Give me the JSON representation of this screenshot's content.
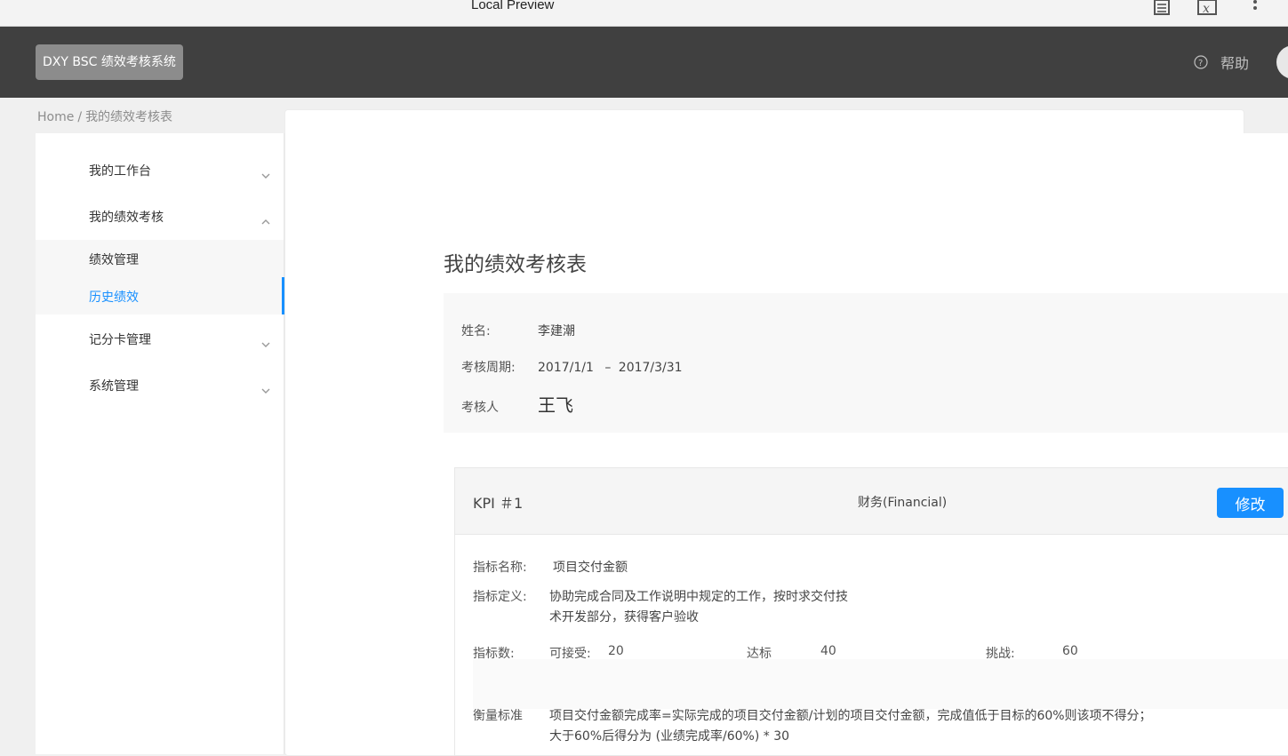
{
  "preview": {
    "title": "Local Preview"
  },
  "header": {
    "brand": "DXY BSC 绩效考核系统",
    "help_label": "帮助"
  },
  "breadcrumb": {
    "home": "Home",
    "separator": "/",
    "current": "我的绩效考核表"
  },
  "sidebar": {
    "items": [
      {
        "label": "我的工作台",
        "expanded": false
      },
      {
        "label": "我的绩效考核",
        "expanded": true,
        "children": [
          {
            "label": "绩效管理"
          },
          {
            "label": "历史绩效",
            "active": true
          }
        ]
      },
      {
        "label": "记分卡管理",
        "expanded": false
      },
      {
        "label": "系统管理",
        "expanded": false
      }
    ]
  },
  "main": {
    "title": "我的绩效考核表",
    "info": {
      "name_label": "姓名:",
      "name_value": "李建潮",
      "period_label": "考核周期:",
      "period_start": "2017/1/1",
      "period_sep": "–",
      "period_end": "2017/3/31",
      "reviewer_label": "考核人",
      "reviewer_value": "王飞"
    },
    "kpi": {
      "number": "KPI ＃1",
      "category": "财务(Financial)",
      "edit_label": "修改",
      "name_label": "指标名称:",
      "name_value": "项目交付金额",
      "definition_label": "指标定义:",
      "definition_lines": [
        "协助完成合同及工作说明中规定的工作，按时求交付技",
        "术开发部分，获得客户验收"
      ],
      "targets_label": "指标数:",
      "acceptable_label": "可接受:",
      "acceptable_value": "20",
      "target_label": "达标",
      "target_value": "40",
      "challenge_label": "挑战:",
      "challenge_value": "60",
      "measure_label": "衡量标准",
      "measure_lines": [
        "项目交付金额完成率=实际完成的项目交付金额/计划的项目交付金额，完成值低于目标的60%则该项不得分；",
        "大于60%后得分为 (业绩完成率/60%) * 30"
      ]
    }
  },
  "colors": {
    "primary": "#1890ff",
    "header_bg": "#404040",
    "brand_bg": "#8c8c8c"
  }
}
